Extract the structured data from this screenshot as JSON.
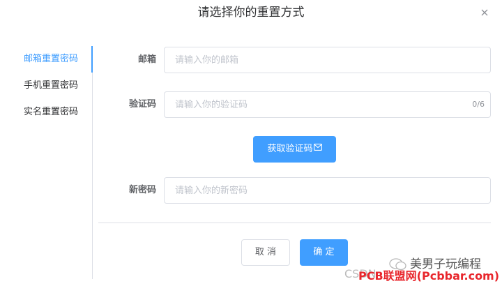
{
  "dialog": {
    "title": "请选择你的重置方式"
  },
  "sidebar": {
    "items": [
      {
        "label": "邮箱重置密码",
        "active": true
      },
      {
        "label": "手机重置密码",
        "active": false
      },
      {
        "label": "实名重置密码",
        "active": false
      }
    ]
  },
  "form": {
    "email": {
      "label": "邮箱",
      "placeholder": "请输入你的邮箱",
      "value": ""
    },
    "code": {
      "label": "验证码",
      "placeholder": "请输入你的验证码",
      "value": "",
      "counter": "0/6"
    },
    "get_code_label": "获取验证码",
    "new_password": {
      "label": "新密码",
      "placeholder": "请输入你的新密码",
      "value": ""
    }
  },
  "footer": {
    "cancel_label": "取 消",
    "confirm_label": "确 定"
  },
  "watermarks": {
    "wechat": "美男子玩编程",
    "csdn": "CSDN",
    "pcb": "PCB联盟网(Pcbbar.com)"
  },
  "colors": {
    "primary": "#409eff",
    "border": "#dcdfe6",
    "placeholder": "#c0c4cc",
    "watermark_red": "#e8262c"
  }
}
